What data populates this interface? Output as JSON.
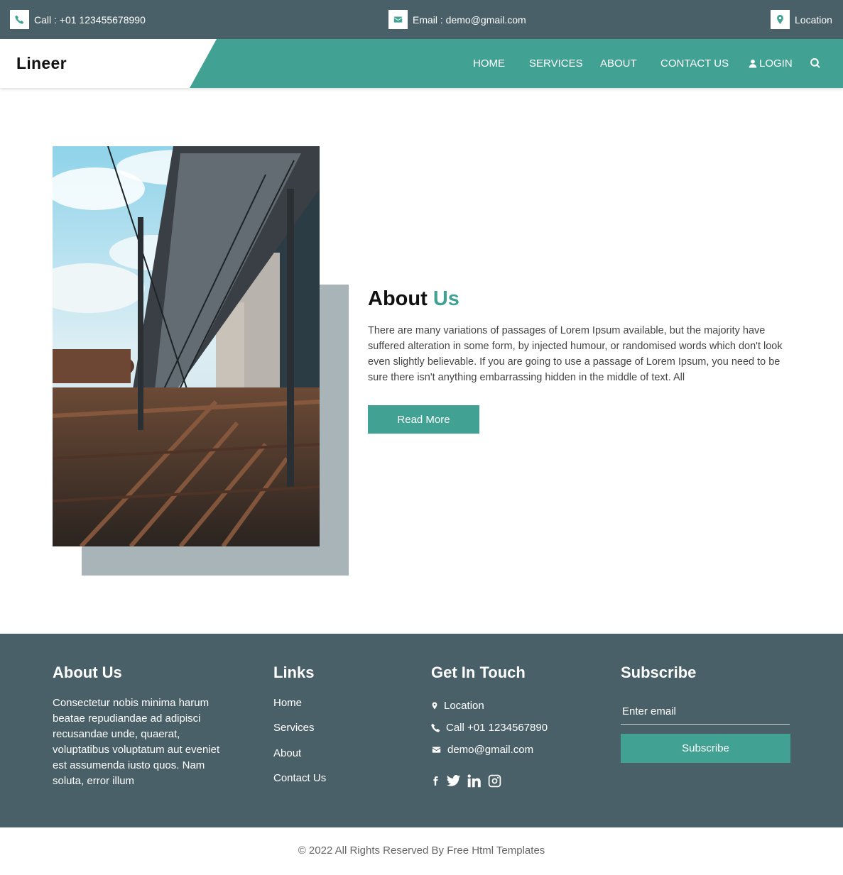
{
  "topbar": {
    "call": "Call : +01 123455678990",
    "email": "Email : demo@gmail.com",
    "location": "Location"
  },
  "header": {
    "brand": "Lineer",
    "nav": {
      "home": "HOME",
      "services": "SERVICES",
      "about": "ABOUT",
      "contact": "CONTACT US",
      "login": "LOGIN"
    }
  },
  "about": {
    "title_main": "About",
    "title_highlight": "Us",
    "text": "There are many variations of passages of Lorem Ipsum available, but the majority have suffered alteration in some form, by injected humour, or randomised words which don't look even slightly believable. If you are going to use a passage of Lorem Ipsum, you need to be sure there isn't anything embarrassing hidden in the middle of text. All",
    "button": "Read More"
  },
  "footer": {
    "about_title": "About Us",
    "about_text": "Consectetur nobis minima harum beatae repudiandae ad adipisci recusandae unde, quaerat, voluptatibus voluptatum aut eveniet est assumenda iusto quos. Nam soluta, error illum",
    "links_title": "Links",
    "links": [
      "Home",
      "Services",
      "About",
      "Contact Us"
    ],
    "touch_title": "Get In Touch",
    "touch": {
      "location": "Location",
      "call": "Call +01 1234567890",
      "email": "demo@gmail.com"
    },
    "subscribe_title": "Subscribe",
    "email_placeholder": "Enter email",
    "subscribe_button": "Subscribe"
  },
  "copyright": "© 2022 All Rights Reserved By Free Html Templates",
  "colors": {
    "teal": "#41a293",
    "slate": "#4a6068",
    "shadow": "#a8b4b8"
  }
}
